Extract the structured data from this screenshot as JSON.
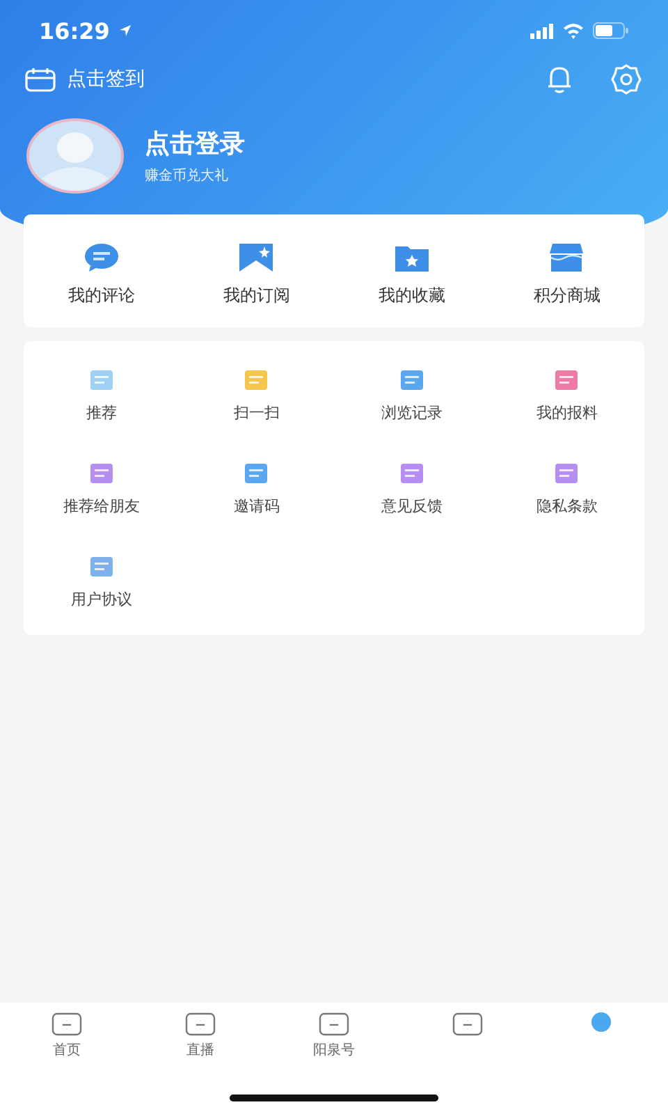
{
  "status_bar": {
    "time": "16:29"
  },
  "header": {
    "sign_in": "点击签到",
    "login_title": "点击登录",
    "login_subtitle": "赚金币兑大礼"
  },
  "quick_actions": [
    {
      "label": "我的评论"
    },
    {
      "label": "我的订阅"
    },
    {
      "label": "我的收藏"
    },
    {
      "label": "积分商城"
    }
  ],
  "services": [
    {
      "label": "推荐"
    },
    {
      "label": "扫一扫"
    },
    {
      "label": "浏览记录"
    },
    {
      "label": "我的报料"
    },
    {
      "label": "推荐给朋友"
    },
    {
      "label": "邀请码"
    },
    {
      "label": "意见反馈"
    },
    {
      "label": "隐私条款"
    },
    {
      "label": "用户协议"
    }
  ],
  "tab_bar": [
    {
      "label": "首页",
      "selected": false
    },
    {
      "label": "直播",
      "selected": false
    },
    {
      "label": "阳泉号",
      "selected": false
    },
    {
      "selected": false
    },
    {
      "selected": true
    }
  ]
}
